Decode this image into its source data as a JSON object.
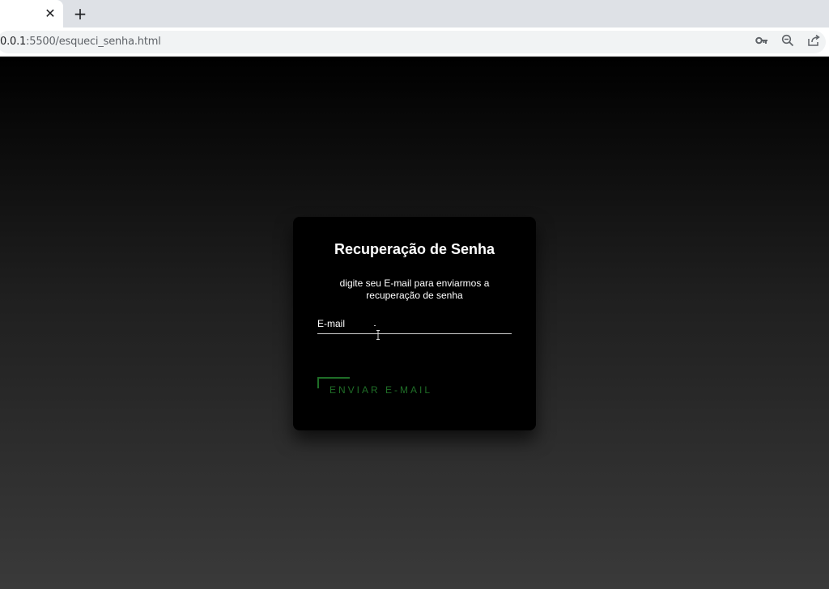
{
  "browser": {
    "tab_close": "✕",
    "new_tab": "+",
    "url_host": "0.0.1",
    "url_rest": ":5500/esqueci_senha.html",
    "icons": [
      "key-icon",
      "zoom-out-icon",
      "share-icon"
    ]
  },
  "form": {
    "title": "Recuperação de Senha",
    "subtitle": "digite seu E-mail para enviarmos a recuperação de senha",
    "email_label": "E-mail",
    "email_value": "",
    "submit_label": "ENVIAR E-MAIL"
  },
  "colors": {
    "accent": "#1f6e27",
    "card_bg": "#000000",
    "text": "#ffffff"
  }
}
